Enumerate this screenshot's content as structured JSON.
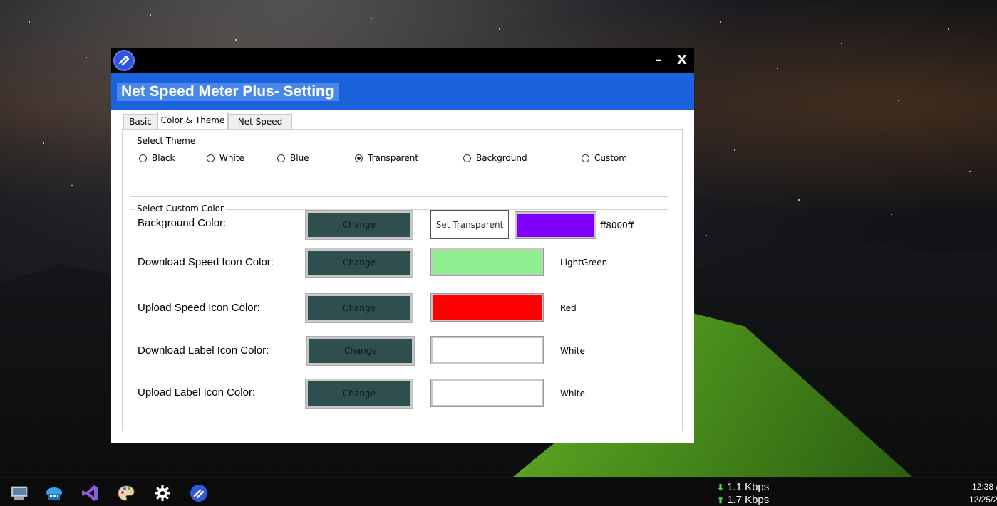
{
  "window": {
    "title": "Net Speed Meter Plus- Setting",
    "minimize_label": "–",
    "close_label": "X"
  },
  "tabs": [
    {
      "label": "Basic",
      "active": false
    },
    {
      "label": "Color & Theme",
      "active": true
    },
    {
      "label": "Net Speed Unit",
      "active": false
    }
  ],
  "theme_group": {
    "title": "Select Theme",
    "options": [
      {
        "label": "Black",
        "checked": false
      },
      {
        "label": "White",
        "checked": false
      },
      {
        "label": "Blue",
        "checked": false
      },
      {
        "label": "Transparent",
        "checked": true
      },
      {
        "label": "Background",
        "checked": false
      },
      {
        "label": "Custom",
        "checked": false
      }
    ]
  },
  "custom_color_group": {
    "title": "Select Custom Color",
    "set_transparent_label": "Set Transparent",
    "rows": [
      {
        "label": "Background Color:",
        "button": "Change",
        "color": "#8000ff",
        "value": "ff8000ff"
      },
      {
        "label": "Download Speed Icon Color:",
        "button": "Change",
        "color": "#90ee90",
        "value": "LightGreen"
      },
      {
        "label": "Upload Speed Icon Color:",
        "button": "Change",
        "color": "#ff0000",
        "value": "Red"
      },
      {
        "label": "Download Label Icon Color:",
        "button": "Change",
        "color": "#ffffff",
        "value": "White"
      },
      {
        "label": "Upload Label Icon Color:",
        "button": "Change",
        "color": "#ffffff",
        "value": "White"
      }
    ]
  },
  "taskbar": {
    "icons": [
      "computer-icon",
      "network-cloud-icon",
      "visual-studio-icon",
      "paint-palette-icon",
      "settings-gear-icon",
      "net-speed-meter-icon"
    ],
    "download_speed": "1.1 Kbps",
    "upload_speed": "1.7 Kbps",
    "time": "12:38 /",
    "date": "12/25/2"
  },
  "colors": {
    "header": "#1b63dd",
    "change_button": "#2f4f4f",
    "speed_arrow": "#4ad04a"
  }
}
